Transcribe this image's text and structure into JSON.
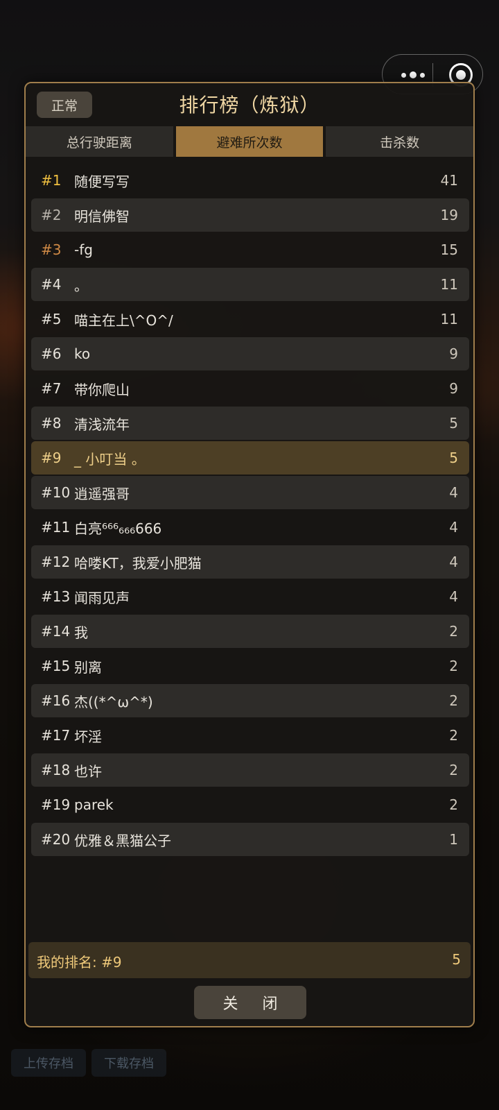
{
  "header": {
    "mode_label": "正常",
    "title": "排行榜（炼狱）"
  },
  "tabs": [
    {
      "label": "总行驶距离",
      "active": false
    },
    {
      "label": "避难所次数",
      "active": true
    },
    {
      "label": "击杀数",
      "active": false
    }
  ],
  "rows": [
    {
      "rank": "#1",
      "name": "随便写写",
      "value": "41"
    },
    {
      "rank": "#2",
      "name": "明信佛智",
      "value": "19"
    },
    {
      "rank": "#3",
      "name": "-fg",
      "value": "15"
    },
    {
      "rank": "#4",
      "name": "。",
      "value": "11"
    },
    {
      "rank": "#5",
      "name": "喵主在上\\^O^/",
      "value": "11"
    },
    {
      "rank": "#6",
      "name": "ko",
      "value": "9"
    },
    {
      "rank": "#7",
      "name": "带你爬山",
      "value": "9"
    },
    {
      "rank": "#8",
      "name": "清浅流年",
      "value": "5"
    },
    {
      "rank": "#9",
      "name": "_ 小叮当 。",
      "value": "5"
    },
    {
      "rank": "#10",
      "name": "逍遥强哥",
      "value": "4"
    },
    {
      "rank": "#11",
      "name": "白亮⁶⁶⁶₆₆₆666",
      "value": "4"
    },
    {
      "rank": "#12",
      "name": "哈喽KT，我爱小肥猫",
      "value": "4"
    },
    {
      "rank": "#13",
      "name": "闻雨见声",
      "value": "4"
    },
    {
      "rank": "#14",
      "name": "我",
      "value": "2"
    },
    {
      "rank": "#15",
      "name": "别离",
      "value": "2"
    },
    {
      "rank": "#16",
      "name": "杰((*^ω^*)",
      "value": "2"
    },
    {
      "rank": "#17",
      "name": "坏淫",
      "value": "2"
    },
    {
      "rank": "#18",
      "name": "也许",
      "value": "2"
    },
    {
      "rank": "#19",
      "name": "parek",
      "value": "2"
    },
    {
      "rank": "#20",
      "name": "优雅＆黑猫公子",
      "value": "1"
    }
  ],
  "my_rank": {
    "label": "我的排名: #9",
    "value": "5"
  },
  "close_label": "关 闭",
  "bottom_buttons": {
    "upload": "上传存档",
    "download": "下载存档"
  },
  "colors": {
    "accent": "#a0783f",
    "gold": "#f0c040",
    "bronze": "#d08a46",
    "highlight": "#efd08a"
  }
}
